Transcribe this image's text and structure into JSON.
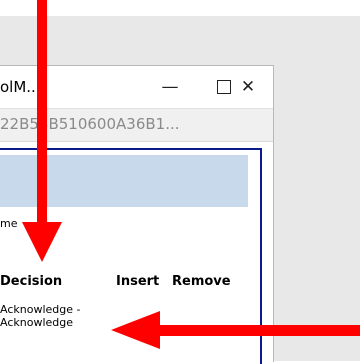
{
  "window": {
    "title": "olM...",
    "address": "22B53B510600A36B1...",
    "minimize_symbol": "—",
    "close_symbol": "✕"
  },
  "form": {
    "field_label": "me",
    "columns": {
      "decision": "Decision",
      "insert": "Insert",
      "remove": "Remove"
    },
    "rows": [
      {
        "decision_line1": "Acknowledge -",
        "decision_line2": "Acknowledge"
      }
    ]
  },
  "colors": {
    "annotation_arrow": "#ff0000",
    "content_border": "#0a1a8a",
    "selection": "#c9d9ec"
  }
}
